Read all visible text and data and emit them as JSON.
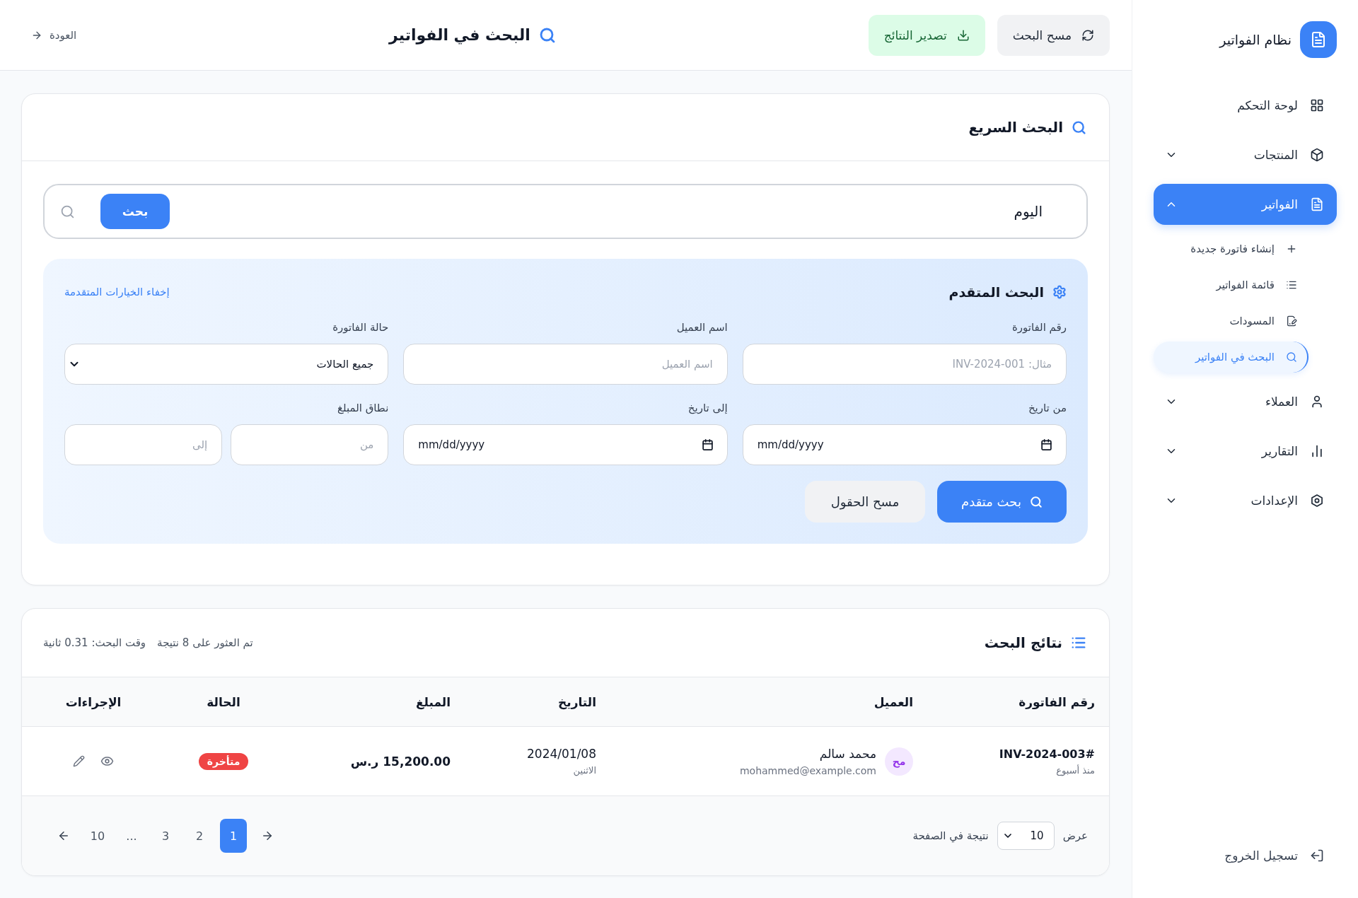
{
  "sidebar": {
    "brand": "نظام الفواتير",
    "items": [
      {
        "label": "لوحة التحكم",
        "kind": "link",
        "selected": false
      },
      {
        "label": "المنتجات",
        "kind": "group",
        "selected": false,
        "expanded": false
      },
      {
        "label": "الفواتير",
        "kind": "group",
        "selected": true,
        "expanded": true,
        "children": [
          {
            "label": "إنشاء فاتورة جديدة",
            "selected": false
          },
          {
            "label": "قائمة الفواتير",
            "selected": false
          },
          {
            "label": "المسودات",
            "selected": false
          },
          {
            "label": "البحث في الفواتير",
            "selected": true
          }
        ]
      },
      {
        "label": "العملاء",
        "kind": "group",
        "selected": false,
        "expanded": false
      },
      {
        "label": "التقارير",
        "kind": "group",
        "selected": false,
        "expanded": false
      },
      {
        "label": "الإعدادات",
        "kind": "group",
        "selected": false,
        "expanded": false
      }
    ],
    "logout": "تسجيل الخروج"
  },
  "header": {
    "actions": [
      {
        "label": "مسح البحث",
        "kind": "secondary"
      },
      {
        "label": "تصدير النتائج",
        "kind": "success"
      }
    ],
    "title": "البحث في الفواتير",
    "back": "العودة"
  },
  "quick_search": {
    "title": "البحث السريع",
    "value": "اليوم",
    "button": "بحث"
  },
  "advanced_search": {
    "title": "البحث المتقدم",
    "toggle": "إخفاء الخيارات المتقدمة",
    "fields": [
      {
        "label": "رقم الفاتورة",
        "kind": "text",
        "placeholder": "مثال: INV-2024-001"
      },
      {
        "label": "اسم العميل",
        "kind": "text",
        "placeholder": "اسم العميل"
      },
      {
        "label": "حالة الفاتورة",
        "kind": "select",
        "value": "جميع الحالات"
      },
      {
        "label": "من تاريخ",
        "kind": "date",
        "placeholder": "mm/dd/yyyy"
      },
      {
        "label": "إلى تاريخ",
        "kind": "date",
        "placeholder": "mm/dd/yyyy"
      },
      {
        "label": "نطاق المبلغ",
        "kind": "range",
        "inputs": [
          {
            "placeholder": "من"
          },
          {
            "placeholder": "إلى"
          }
        ]
      }
    ],
    "buttons": [
      {
        "label": "بحث متقدم",
        "kind": "primary"
      },
      {
        "label": "مسح الحقول",
        "kind": "secondary"
      }
    ]
  },
  "results": {
    "title": "نتائج البحث",
    "summary": [
      "تم العثور على 8 نتيجة",
      "وقت البحث: 0.31 ثانية"
    ],
    "table": {
      "columns": [
        "رقم الفاتورة",
        "العميل",
        "التاريخ",
        "المبلغ",
        "الحالة",
        "الإجراءات"
      ],
      "rows": [
        {
          "invoice": "#INV-2024-003",
          "age": "منذ أسبوع",
          "customer": {
            "initials": "مح",
            "name": "محمد سالم",
            "email": "mohammed@example.com"
          },
          "date": "2024/01/08",
          "weekday": "الاثنين",
          "amount": "15,200.00 ر.س",
          "status": {
            "label": "متأخرة",
            "color": "#ef4444"
          }
        }
      ]
    },
    "pagination": {
      "show_label": "عرض",
      "per_page": "10",
      "per_page_label": "نتيجة في الصفحة",
      "pages": [
        {
          "label": "1",
          "kind": "page",
          "selected": true
        },
        {
          "label": "2",
          "kind": "page",
          "selected": false
        },
        {
          "label": "3",
          "kind": "page",
          "selected": false
        },
        {
          "label": "...",
          "kind": "gap"
        },
        {
          "label": "10",
          "kind": "page",
          "selected": false
        }
      ]
    }
  }
}
